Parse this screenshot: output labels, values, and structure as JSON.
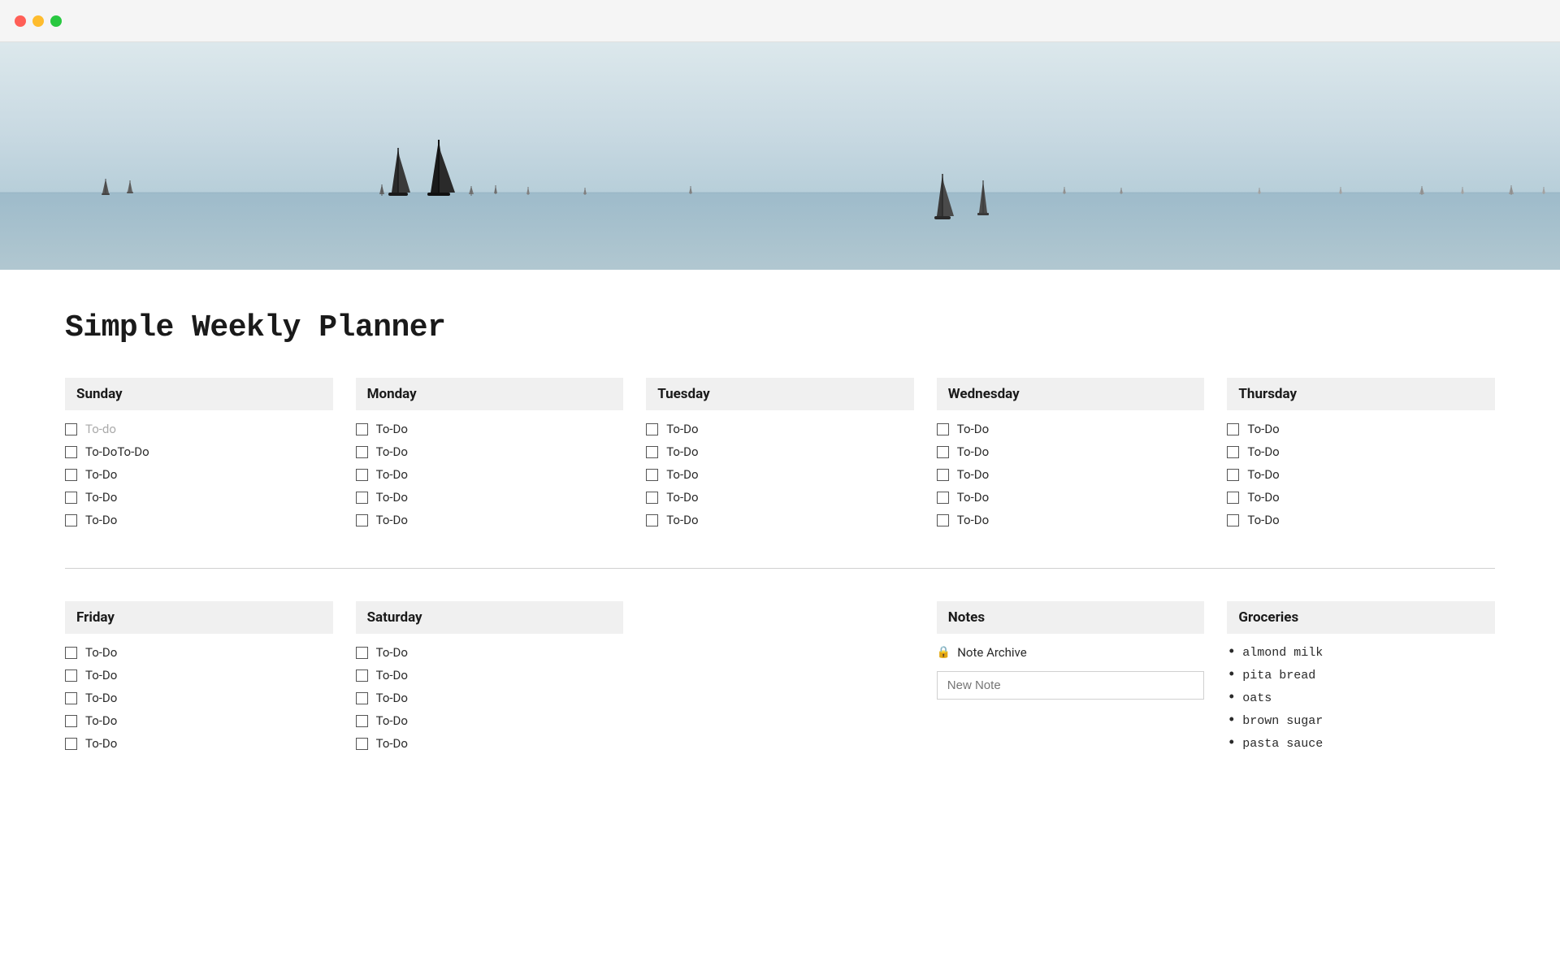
{
  "titlebar": {
    "close_color": "#FF5F57",
    "minimize_color": "#FEBC2E",
    "maximize_color": "#28C840"
  },
  "page": {
    "title": "Simple Weekly Planner"
  },
  "days_top": [
    {
      "name": "Sunday",
      "items": [
        {
          "label": "To-do",
          "placeholder": true
        },
        {
          "label": "To-DoTo-Do",
          "placeholder": false
        },
        {
          "label": "To-Do",
          "placeholder": false
        },
        {
          "label": "To-Do",
          "placeholder": false
        },
        {
          "label": "To-Do",
          "placeholder": false
        }
      ]
    },
    {
      "name": "Monday",
      "items": [
        {
          "label": "To-Do",
          "placeholder": false
        },
        {
          "label": "To-Do",
          "placeholder": false
        },
        {
          "label": "To-Do",
          "placeholder": false
        },
        {
          "label": "To-Do",
          "placeholder": false
        },
        {
          "label": "To-Do",
          "placeholder": false
        }
      ]
    },
    {
      "name": "Tuesday",
      "items": [
        {
          "label": "To-Do",
          "placeholder": false
        },
        {
          "label": "To-Do",
          "placeholder": false
        },
        {
          "label": "To-Do",
          "placeholder": false
        },
        {
          "label": "To-Do",
          "placeholder": false
        },
        {
          "label": "To-Do",
          "placeholder": false
        }
      ]
    },
    {
      "name": "Wednesday",
      "items": [
        {
          "label": "To-Do",
          "placeholder": false
        },
        {
          "label": "To-Do",
          "placeholder": false
        },
        {
          "label": "To-Do",
          "placeholder": false
        },
        {
          "label": "To-Do",
          "placeholder": false
        },
        {
          "label": "To-Do",
          "placeholder": false
        }
      ]
    },
    {
      "name": "Thursday",
      "items": [
        {
          "label": "To-Do",
          "placeholder": false
        },
        {
          "label": "To-Do",
          "placeholder": false
        },
        {
          "label": "To-Do",
          "placeholder": false
        },
        {
          "label": "To-Do",
          "placeholder": false
        },
        {
          "label": "To-Do",
          "placeholder": false
        }
      ]
    }
  ],
  "days_bottom": [
    {
      "name": "Friday",
      "items": [
        {
          "label": "To-Do"
        },
        {
          "label": "To-Do"
        },
        {
          "label": "To-Do"
        },
        {
          "label": "To-Do"
        },
        {
          "label": "To-Do"
        }
      ]
    },
    {
      "name": "Saturday",
      "items": [
        {
          "label": "To-Do"
        },
        {
          "label": "To-Do"
        },
        {
          "label": "To-Do"
        },
        {
          "label": "To-Do"
        },
        {
          "label": "To-Do"
        }
      ]
    }
  ],
  "notes": {
    "header": "Notes",
    "archive_label": "Note Archive",
    "new_note_placeholder": "New Note"
  },
  "groceries": {
    "header": "Groceries",
    "items": [
      "almond milk",
      "pita bread",
      "oats",
      "brown sugar",
      "pasta sauce"
    ]
  }
}
